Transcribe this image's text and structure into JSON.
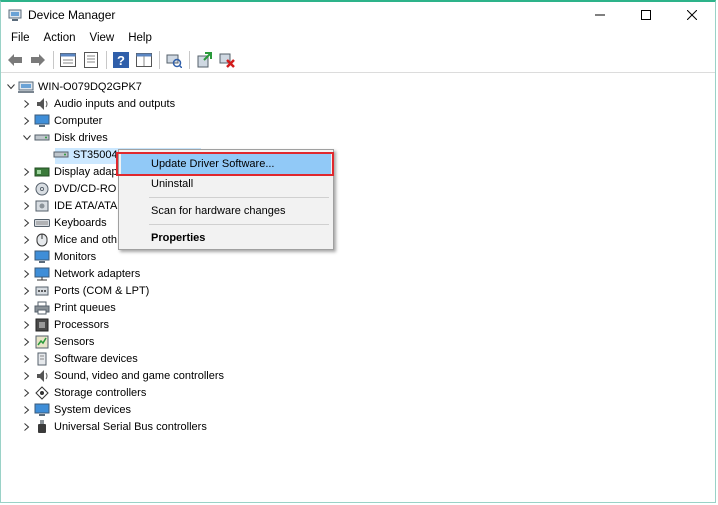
{
  "window": {
    "title": "Device Manager"
  },
  "menu": [
    "File",
    "Action",
    "View",
    "Help"
  ],
  "toolbar": {
    "buttons": [
      "back-icon",
      "forward-icon",
      "properties-sheet-icon",
      "update-list-icon",
      "help-icon",
      "action-pane-icon",
      "scan-hardware-icon",
      "update-driver-icon",
      "uninstall-device-icon"
    ]
  },
  "tree": {
    "root": "WIN-O079DQ2GPK7",
    "categories": [
      {
        "label": "Audio inputs and outputs",
        "icon": "audio-icon",
        "expanded": false
      },
      {
        "label": "Computer",
        "icon": "computer-icon",
        "expanded": false
      },
      {
        "label": "Disk drives",
        "icon": "disk-drive-icon",
        "expanded": true,
        "children": [
          "ST35004"
        ]
      },
      {
        "label": "Display adap",
        "icon": "display-adapter-icon",
        "expanded": false
      },
      {
        "label": "DVD/CD-RO",
        "icon": "dvd-icon",
        "expanded": false
      },
      {
        "label": "IDE ATA/ATA",
        "icon": "ide-icon",
        "expanded": false
      },
      {
        "label": "Keyboards",
        "icon": "keyboard-icon",
        "expanded": false
      },
      {
        "label": "Mice and oth",
        "icon": "mouse-icon",
        "expanded": false
      },
      {
        "label": "Monitors",
        "icon": "monitor-icon",
        "expanded": false
      },
      {
        "label": "Network adapters",
        "icon": "network-icon",
        "expanded": false
      },
      {
        "label": "Ports (COM & LPT)",
        "icon": "port-icon",
        "expanded": false
      },
      {
        "label": "Print queues",
        "icon": "printer-icon",
        "expanded": false
      },
      {
        "label": "Processors",
        "icon": "processor-icon",
        "expanded": false
      },
      {
        "label": "Sensors",
        "icon": "sensor-icon",
        "expanded": false
      },
      {
        "label": "Software devices",
        "icon": "software-device-icon",
        "expanded": false
      },
      {
        "label": "Sound, video and game controllers",
        "icon": "sound-icon",
        "expanded": false
      },
      {
        "label": "Storage controllers",
        "icon": "storage-icon",
        "expanded": false
      },
      {
        "label": "System devices",
        "icon": "system-icon",
        "expanded": false
      },
      {
        "label": "Universal Serial Bus controllers",
        "icon": "usb-icon",
        "expanded": false
      }
    ]
  },
  "context_menu": {
    "items": [
      {
        "label": "Update Driver Software...",
        "highlighted": true,
        "bold": false
      },
      {
        "label": "Uninstall",
        "highlighted": false,
        "bold": false
      },
      {
        "label": "Scan for hardware changes",
        "highlighted": false,
        "bold": false
      },
      {
        "label": "Properties",
        "highlighted": false,
        "bold": true
      }
    ]
  },
  "colors": {
    "highlight": "#91c9f7",
    "selection": "#cce8ff",
    "annotation": "#e0282e",
    "title_accent": "#2db38a"
  }
}
